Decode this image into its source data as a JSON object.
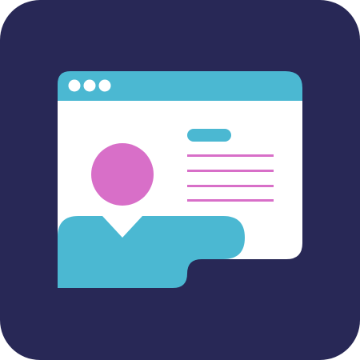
{
  "icon": {
    "name": "presenter-web-page-icon",
    "colors": {
      "background": "#282856",
      "window": "#ffffff",
      "accent": "#4bb8d2",
      "highlight": "#d86fc8"
    }
  }
}
